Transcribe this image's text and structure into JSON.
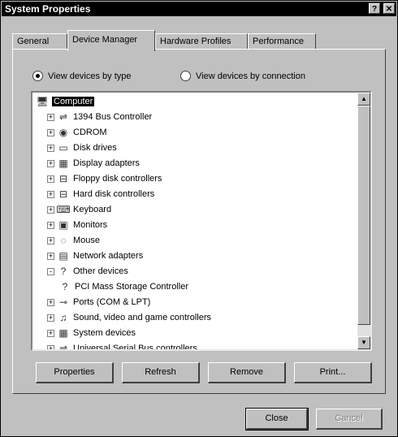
{
  "window": {
    "title": "System Properties",
    "help_glyph": "?",
    "close_glyph": "✕"
  },
  "tabs": [
    {
      "label": "General"
    },
    {
      "label": "Device Manager",
      "active": true
    },
    {
      "label": "Hardware Profiles"
    },
    {
      "label": "Performance"
    }
  ],
  "view_options": {
    "by_type": "View devices by type",
    "by_connection": "View devices by connection",
    "selected": "by_type"
  },
  "tree": [
    {
      "label": "Computer",
      "icon": "computer-icon",
      "glyph": "🖥",
      "level": 0,
      "selected": true
    },
    {
      "label": "1394 Bus Controller",
      "icon": "bus-controller-icon",
      "glyph": "⇌",
      "level": 1,
      "expander": "+"
    },
    {
      "label": "CDROM",
      "icon": "cdrom-icon",
      "glyph": "◉",
      "level": 1,
      "expander": "+"
    },
    {
      "label": "Disk drives",
      "icon": "disk-drive-icon",
      "glyph": "▭",
      "level": 1,
      "expander": "+"
    },
    {
      "label": "Display adapters",
      "icon": "display-adapter-icon",
      "glyph": "▦",
      "level": 1,
      "expander": "+"
    },
    {
      "label": "Floppy disk controllers",
      "icon": "floppy-controller-icon",
      "glyph": "⊟",
      "level": 1,
      "expander": "+"
    },
    {
      "label": "Hard disk controllers",
      "icon": "hard-disk-controller-icon",
      "glyph": "⊟",
      "level": 1,
      "expander": "+"
    },
    {
      "label": "Keyboard",
      "icon": "keyboard-icon",
      "glyph": "⌨",
      "level": 1,
      "expander": "+"
    },
    {
      "label": "Monitors",
      "icon": "monitor-icon",
      "glyph": "▣",
      "level": 1,
      "expander": "+"
    },
    {
      "label": "Mouse",
      "icon": "mouse-icon",
      "glyph": "◌",
      "level": 1,
      "expander": "+"
    },
    {
      "label": "Network adapters",
      "icon": "network-adapter-icon",
      "glyph": "▤",
      "level": 1,
      "expander": "+"
    },
    {
      "label": "Other devices",
      "icon": "question-icon",
      "glyph": "?",
      "level": 1,
      "expander": "-"
    },
    {
      "label": "PCI Mass Storage Controller",
      "icon": "question-icon",
      "glyph": "?",
      "level": 2
    },
    {
      "label": "Ports (COM & LPT)",
      "icon": "port-icon",
      "glyph": "⊸",
      "level": 1,
      "expander": "+"
    },
    {
      "label": "Sound, video and game controllers",
      "icon": "sound-icon",
      "glyph": "♫",
      "level": 1,
      "expander": "+"
    },
    {
      "label": "System devices",
      "icon": "system-devices-icon",
      "glyph": "▦",
      "level": 1,
      "expander": "+"
    },
    {
      "label": "Universal Serial Bus controllers",
      "icon": "usb-icon",
      "glyph": "⇌",
      "level": 1,
      "expander": "+"
    }
  ],
  "actions": {
    "properties": "Properties",
    "refresh": "Refresh",
    "remove": "Remove",
    "print": "Print..."
  },
  "dialog_buttons": {
    "close": "Close",
    "cancel": "Cancel"
  }
}
